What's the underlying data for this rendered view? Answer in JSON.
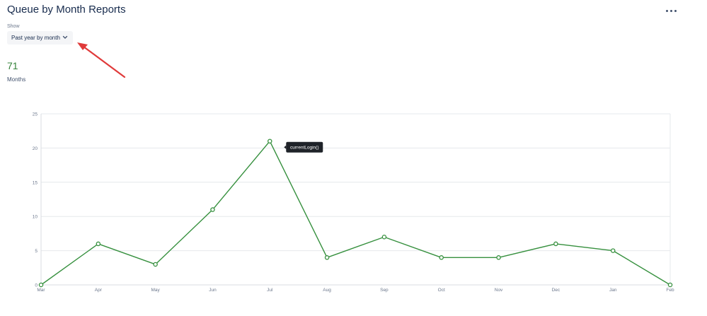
{
  "header": {
    "title": "Queue by Month Reports"
  },
  "filter": {
    "label": "Show",
    "selected": "Past year by month"
  },
  "summary": {
    "value": "71",
    "label": "Months"
  },
  "icons": {
    "more": "more-horizontal-icon",
    "dropdown": "chevron-down-icon"
  },
  "colors": {
    "line": "#36903e",
    "value_text": "#36833b",
    "annotation_arrow": "#e03a3a"
  },
  "chart_data": {
    "type": "line",
    "categories": [
      "Mar",
      "Apr",
      "May",
      "Jun",
      "Jul",
      "Aug",
      "Sep",
      "Oct",
      "Nov",
      "Dec",
      "Jan",
      "Feb"
    ],
    "series": [
      {
        "values": [
          0,
          6,
          3,
          11,
          21,
          4,
          7,
          4,
          4,
          6,
          5,
          0
        ]
      }
    ],
    "ylim": [
      0,
      25
    ],
    "yticks": [
      0,
      5,
      10,
      15,
      20,
      25
    ],
    "grid": true,
    "tooltip": {
      "text": "currentLogin()",
      "category": "Jul"
    }
  }
}
